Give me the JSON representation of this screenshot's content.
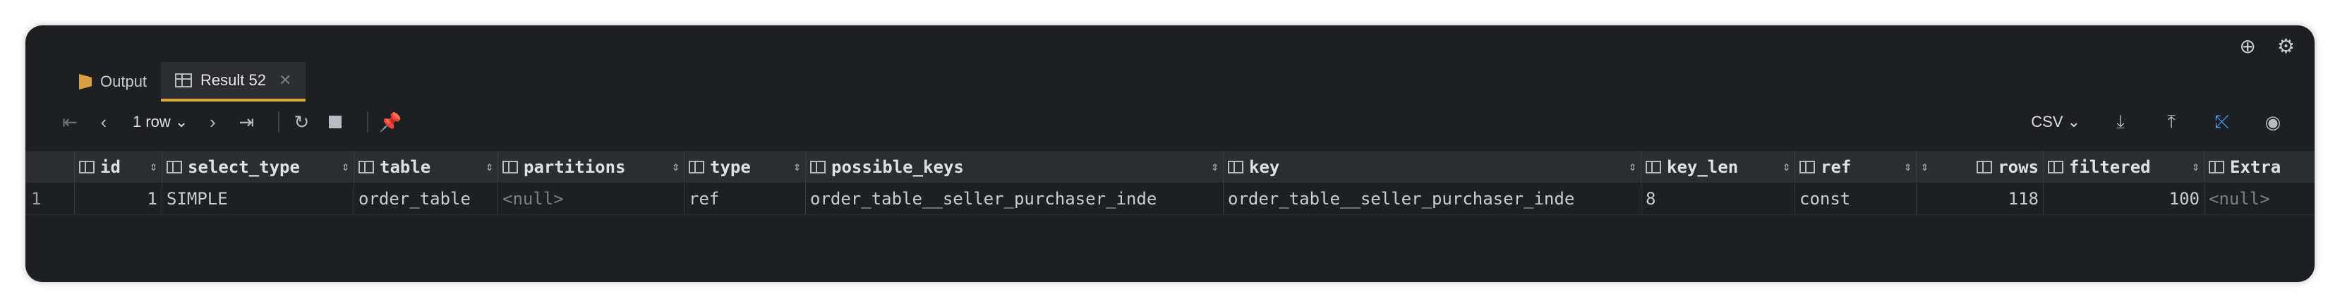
{
  "tabs": [
    {
      "label": "Output",
      "icon": "output-icon"
    },
    {
      "label": "Result 52",
      "icon": "result-grid-icon",
      "active": true
    }
  ],
  "toolbar": {
    "rows_label": "1 row",
    "format_label": "CSV"
  },
  "table": {
    "columns": [
      "id",
      "select_type",
      "table",
      "partitions",
      "type",
      "possible_keys",
      "key",
      "key_len",
      "ref",
      "rows",
      "filtered",
      "Extra"
    ],
    "rows": [
      {
        "rownum": "1",
        "values": [
          "1",
          "SIMPLE",
          "order_table",
          "<null>",
          "ref",
          "order_table__seller_purchaser_inde",
          "order_table__seller_purchaser_inde",
          "8",
          "const",
          "118",
          "100",
          "<null>"
        ]
      }
    ]
  },
  "colors": {
    "background": "#1e1f22",
    "header": "#2b2d30",
    "accent": "#d6a83a",
    "link": "#4a9df8"
  }
}
